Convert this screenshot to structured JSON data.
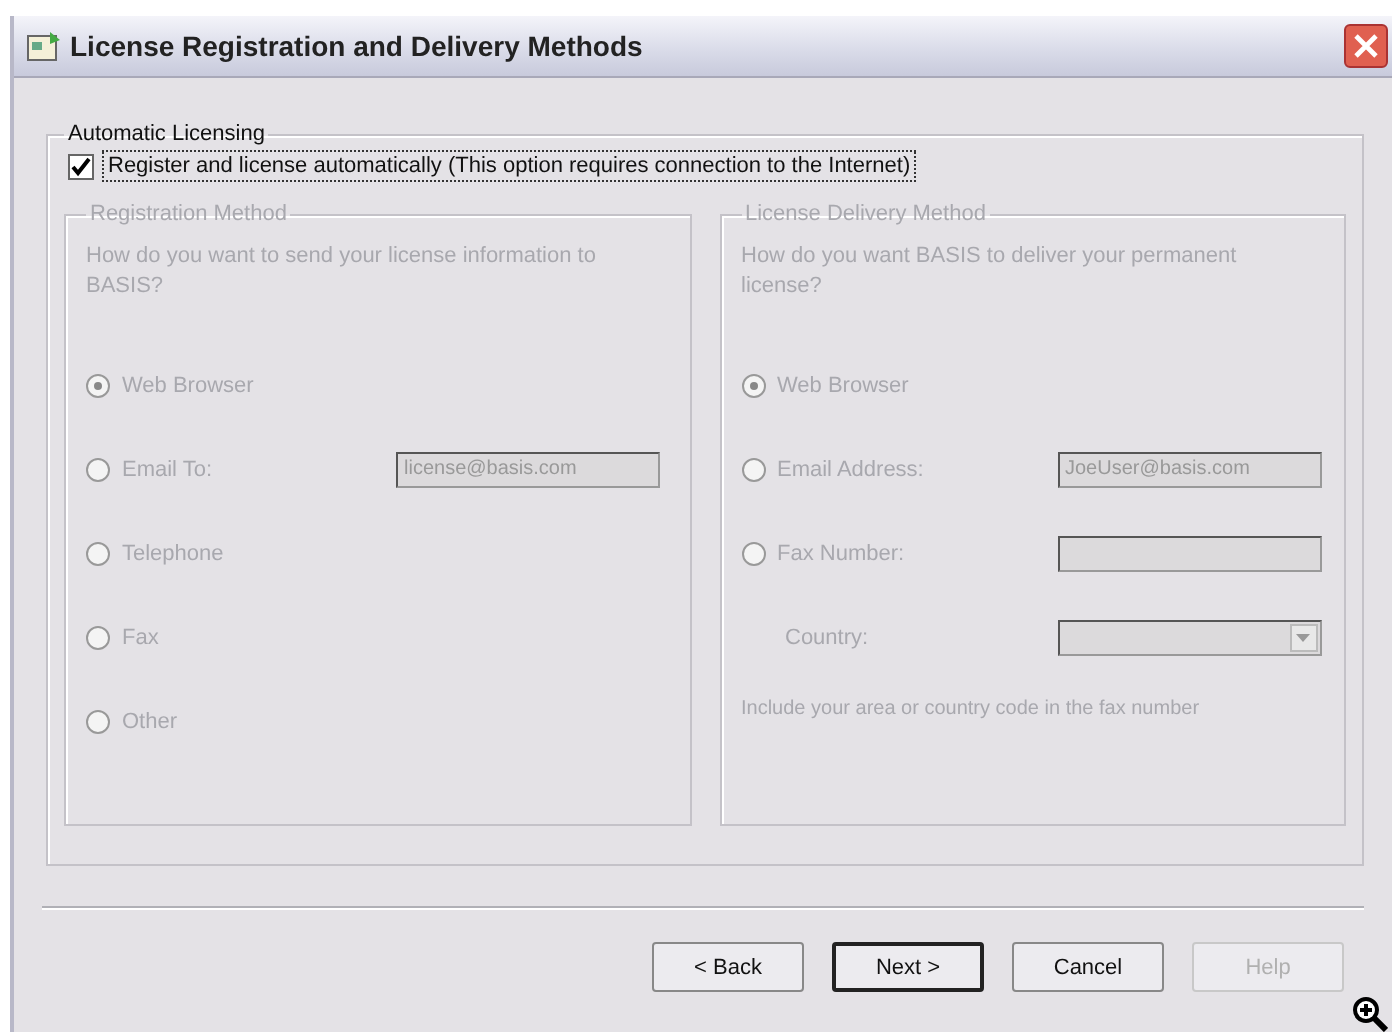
{
  "window": {
    "title": "License Registration and Delivery Methods"
  },
  "automatic_licensing": {
    "label": "Automatic Licensing",
    "checkbox": {
      "label": "Register and license automatically (This option requires connection to the Internet)",
      "checked": true
    }
  },
  "registration_method": {
    "label": "Registration Method",
    "disabled": true,
    "prompt": "How do you want to send your license information to BASIS?",
    "options": [
      {
        "kind": "radio",
        "label": "Web Browser",
        "selected": true
      },
      {
        "kind": "radio_field",
        "label": "Email To:",
        "selected": false,
        "value": "license@basis.com"
      },
      {
        "kind": "radio",
        "label": "Telephone",
        "selected": false
      },
      {
        "kind": "radio",
        "label": "Fax",
        "selected": false
      },
      {
        "kind": "radio",
        "label": "Other",
        "selected": false
      }
    ]
  },
  "delivery_method": {
    "label": "License Delivery Method",
    "disabled": true,
    "prompt": "How do you want BASIS to deliver your permanent license?",
    "options": [
      {
        "kind": "radio",
        "label": "Web Browser",
        "selected": true
      },
      {
        "kind": "radio_field",
        "label": "Email Address:",
        "selected": false,
        "value": "JoeUser@basis.com"
      },
      {
        "kind": "radio_field",
        "label": "Fax Number:",
        "selected": false
      },
      {
        "kind": "dropdown",
        "label": "Country:"
      }
    ],
    "note": "Include your area or country code in the fax number"
  },
  "buttons": [
    {
      "label": "< Back",
      "default": false,
      "disabled": false
    },
    {
      "label": "Next >",
      "default": true,
      "disabled": false
    },
    {
      "label": "Cancel",
      "default": false,
      "disabled": false
    },
    {
      "label": "Help",
      "default": false,
      "disabled": true
    }
  ]
}
